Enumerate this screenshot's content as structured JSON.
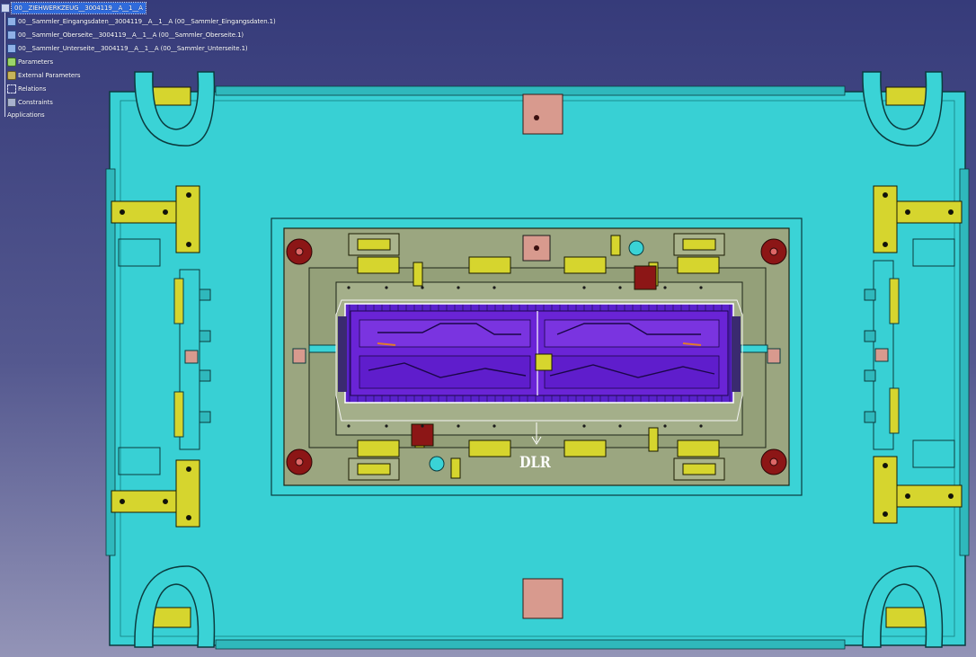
{
  "tree": {
    "root": "00__ZIEHWERKZEUG__3004119__A__1__A",
    "items": [
      "00__Sammler_Eingangsdaten__3004119__A__1__A (00__Sammler_Eingangsdaten.1)",
      "00__Sammler_Oberseite__3004119__A__1__A (00__Sammler_Oberseite.1)",
      "00__Sammler_Unterseite__3004119__A__1__A (00__Sammler_Unterseite.1)",
      "Parameters",
      "External Parameters",
      "Relations",
      "Constraints",
      "Applications"
    ]
  },
  "model": {
    "engraving": "DLR"
  },
  "colors": {
    "background_top": "#3a3f7e",
    "background_bottom": "#8f90b4",
    "base_plate": "#3ad3d6",
    "frame": "#9aa67f",
    "part": "#6a1fd0",
    "handles": "#d9d631",
    "pads": "#d79a8e",
    "bolt": "#8c1616",
    "selection": "#2f6bdc"
  }
}
